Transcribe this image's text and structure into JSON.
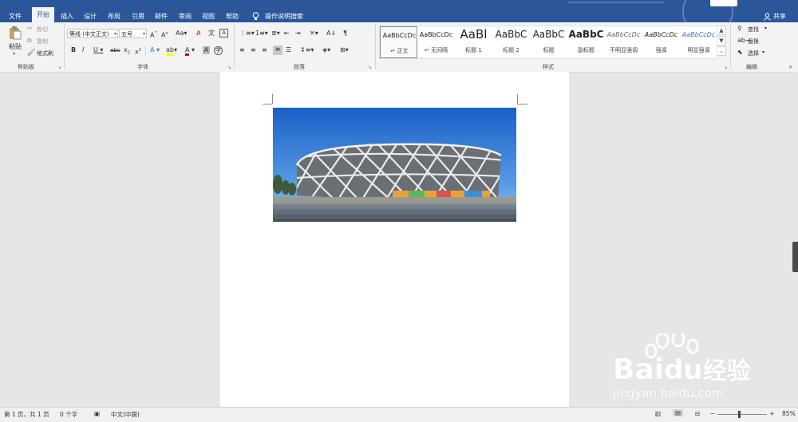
{
  "tabs": [
    "文件",
    "开始",
    "插入",
    "设计",
    "布局",
    "引用",
    "邮件",
    "审阅",
    "视图",
    "帮助"
  ],
  "active_tab": "开始",
  "tell_me": "操作说明搜索",
  "share": "共享",
  "clipboard": {
    "paste": "粘贴",
    "cut": "剪切",
    "copy": "复制",
    "format_painter": "格式刷",
    "label": "剪贴板"
  },
  "font": {
    "name": "等线 (中文正文)",
    "size": "五号",
    "label": "字体"
  },
  "paragraph": {
    "label": "段落"
  },
  "styles": {
    "label": "样式",
    "items": [
      {
        "sample": "AaBbCcDc",
        "name": "↵ 正文"
      },
      {
        "sample": "AaBbCcDc",
        "name": "↵ 无间隔"
      },
      {
        "sample": "AaBl",
        "name": "标题 1"
      },
      {
        "sample": "AaBbC",
        "name": "标题 2"
      },
      {
        "sample": "AaBbC",
        "name": "标题"
      },
      {
        "sample": "AaBbC",
        "name": "副标题"
      },
      {
        "sample": "AaBbCcDc",
        "name": "不明显强调"
      },
      {
        "sample": "AaBbCcDc",
        "name": "强调"
      },
      {
        "sample": "AaBbCcDc",
        "name": "明显强调"
      }
    ]
  },
  "editing": {
    "find": "查找",
    "replace": "替换",
    "select": "选择",
    "label": "编辑"
  },
  "status": {
    "page": "第 1 页，共 1 页",
    "words": "0 个字",
    "language": "中文(中国)",
    "zoom": "85%"
  },
  "watermark": {
    "brand": "Bai",
    "brand_suffix": "经验",
    "url": "jingyan.baidu.com"
  },
  "colors": {
    "ribbon_blue": "#2b579a",
    "ribbon_bg": "#f3f3f3",
    "canvas": "#e6e6e6"
  }
}
